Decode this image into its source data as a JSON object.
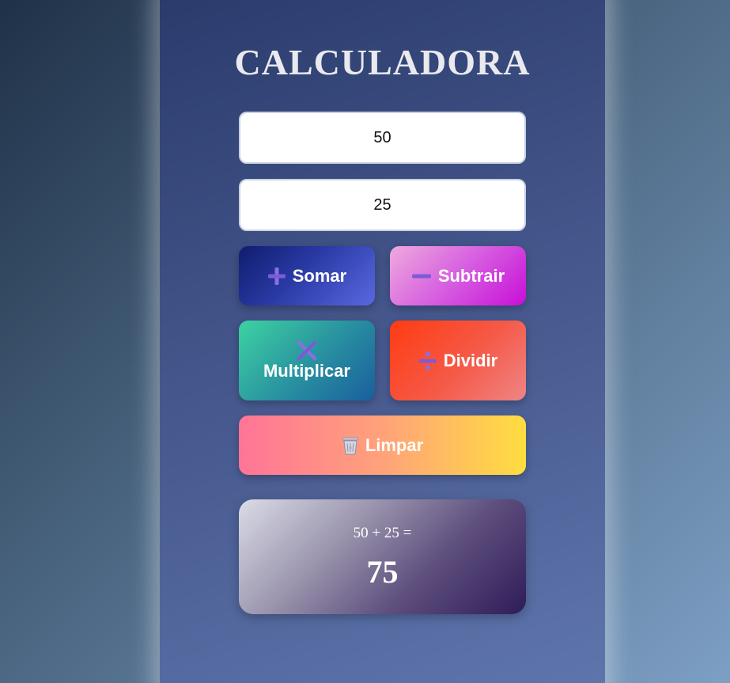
{
  "app": {
    "title": "CALCULADORA"
  },
  "inputs": {
    "first_value": "50",
    "second_value": "25"
  },
  "buttons": {
    "somar": {
      "label": "Somar",
      "icon": "plus-icon"
    },
    "subtrair": {
      "label": "Subtrair",
      "icon": "minus-icon"
    },
    "multiplicar": {
      "label": "Multiplicar",
      "icon": "multiply-icon"
    },
    "dividir": {
      "label": "Dividir",
      "icon": "divide-icon"
    },
    "limpar": {
      "label": "Limpar",
      "icon": "trash-icon"
    }
  },
  "result": {
    "expression": "50 + 25 =",
    "value": "75"
  },
  "colors": {
    "icon_purple": "#7b5cd6",
    "card_top": "#2a3a6b",
    "card_bottom": "#5f76ad"
  }
}
